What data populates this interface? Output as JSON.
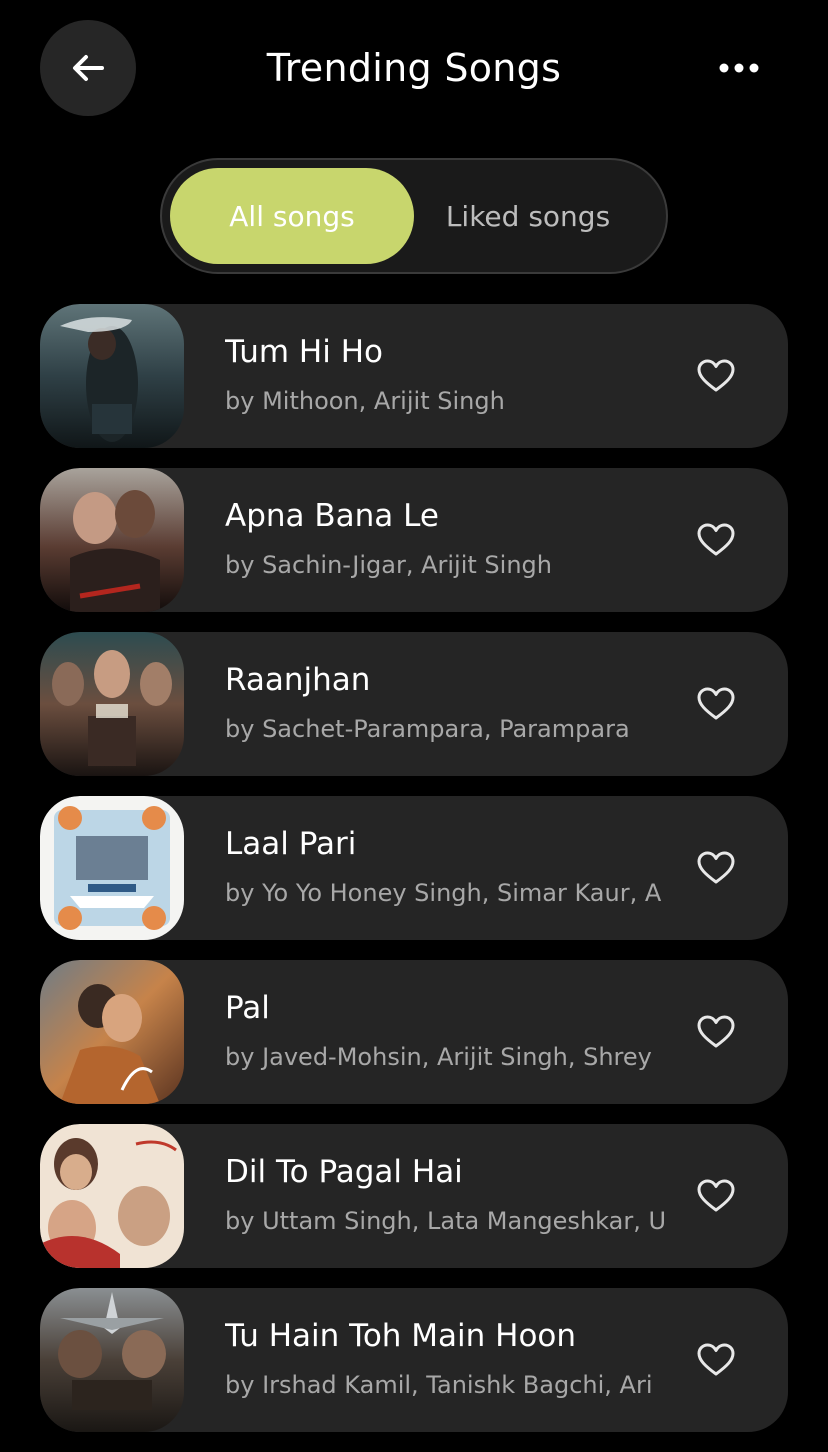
{
  "header": {
    "title": "Trending Songs",
    "back_icon": "arrow-left-icon",
    "more_icon": "more-horizontal-icon"
  },
  "tabs": {
    "active": "All songs",
    "inactive": "Liked songs"
  },
  "colors": {
    "accent": "#c8d66d",
    "card": "#252525",
    "background": "#000000"
  },
  "songs": [
    {
      "title": "Tum Hi Ho",
      "artists": "by Mithoon, Arijit Singh",
      "liked": false
    },
    {
      "title": "Apna Bana Le",
      "artists": "by Sachin-Jigar, Arijit Singh",
      "liked": false
    },
    {
      "title": "Raanjhan",
      "artists": "by Sachet-Parampara, Parampara",
      "liked": false
    },
    {
      "title": "Laal Pari",
      "artists": "by Yo Yo Honey Singh, Simar Kaur, A",
      "liked": false
    },
    {
      "title": "Pal",
      "artists": "by Javed-Mohsin, Arijit Singh, Shrey",
      "liked": false
    },
    {
      "title": "Dil To Pagal Hai",
      "artists": "by Uttam Singh, Lata Mangeshkar, U",
      "liked": false
    },
    {
      "title": "Tu Hain Toh Main Hoon",
      "artists": "by Irshad Kamil, Tanishk Bagchi, Ari",
      "liked": false
    }
  ]
}
